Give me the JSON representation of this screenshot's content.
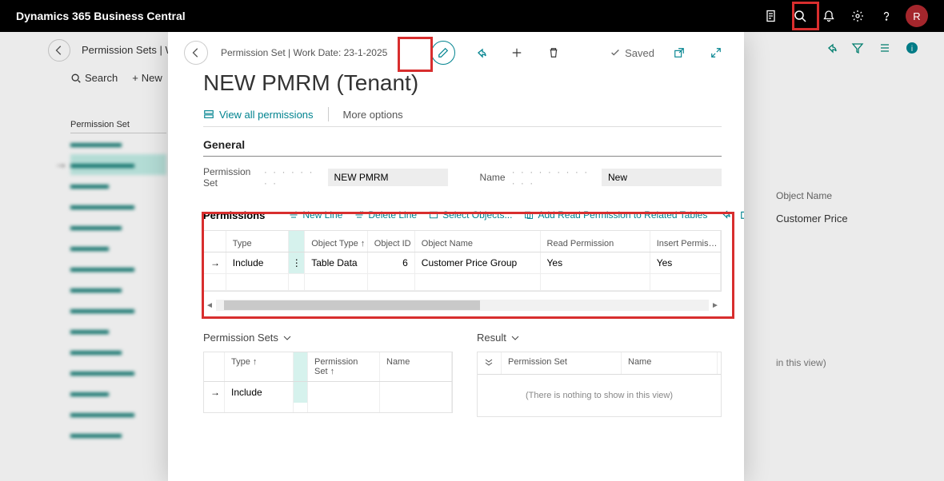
{
  "app_title": "Dynamics 365 Business Central",
  "top_icons": {
    "avatar": "R"
  },
  "bg": {
    "breadcrumb": "Permission Sets | Work Date",
    "search": "Search",
    "new": "New",
    "list_header": "Permission Set",
    "right_col_header": "Object Name",
    "right_col_value": "Customer Price",
    "empty_view_text": "in this view)"
  },
  "modal": {
    "crumb": "Permission Set | Work Date: 23-1-2025",
    "saved": "Saved",
    "title": "NEW PMRM (Tenant)",
    "actions": {
      "view_all": "View all permissions",
      "more": "More options"
    },
    "general": {
      "section": "General",
      "perm_set_label": "Permission Set",
      "perm_set_value": "NEW PMRM",
      "name_label": "Name",
      "name_value": "New"
    },
    "permissions": {
      "title": "Permissions",
      "new_line": "New Line",
      "delete_line": "Delete Line",
      "select_objects": "Select Objects...",
      "add_read": "Add Read Permission to Related Tables",
      "columns": {
        "type": "Type",
        "object_type": "Object Type ↑",
        "object_id": "Object ID ↑",
        "object_name": "Object Name",
        "read": "Read Permission",
        "insert": "Insert Permis…"
      },
      "rows": [
        {
          "type": "Include",
          "object_type": "Table Data",
          "object_id": "6",
          "object_name": "Customer Price Group",
          "read": "Yes",
          "insert": "Yes"
        }
      ]
    },
    "permission_sets_panel": {
      "title": "Permission Sets",
      "columns": {
        "type": "Type ↑",
        "permission_set": "Permission Set ↑",
        "name": "Name"
      },
      "rows": [
        {
          "type": "Include",
          "permission_set": "",
          "name": ""
        }
      ]
    },
    "result_panel": {
      "title": "Result",
      "columns": {
        "permission_set": "Permission Set",
        "name": "Name"
      },
      "empty": "(There is nothing to show in this view)"
    }
  }
}
